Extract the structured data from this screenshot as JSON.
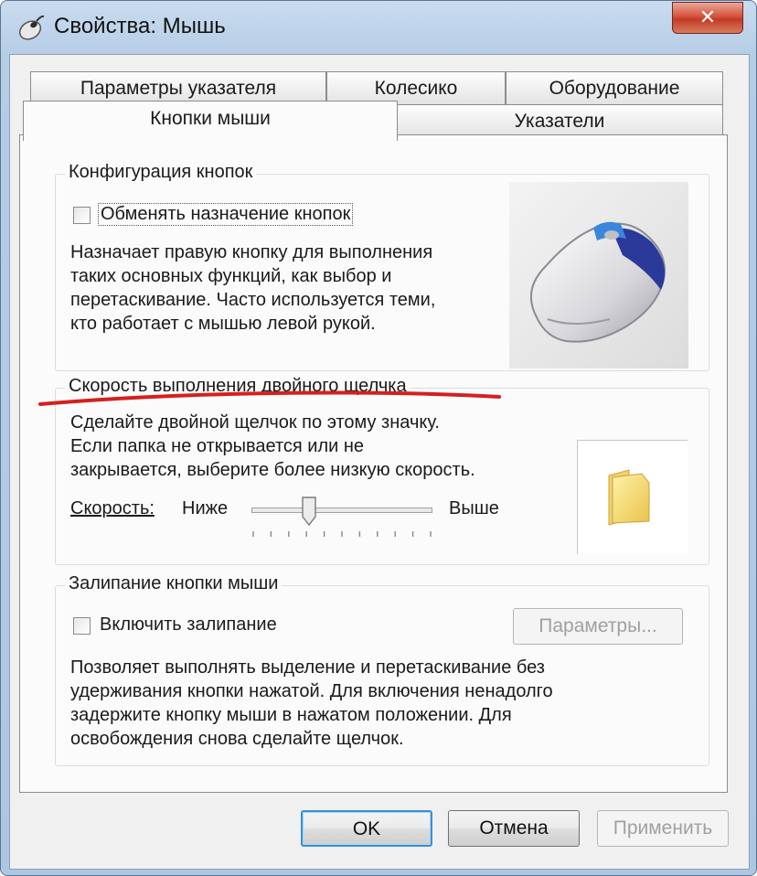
{
  "window": {
    "title": "Свойства: Мышь",
    "close_glyph": "✕"
  },
  "tabs_row1": [
    {
      "label": "Параметры указателя"
    },
    {
      "label": "Колесико"
    },
    {
      "label": "Оборудование"
    }
  ],
  "tabs_row2": [
    {
      "label": "Кнопки мыши",
      "active": true
    },
    {
      "label": "Указатели"
    }
  ],
  "buttons_config": {
    "legend": "Конфигурация кнопок",
    "checkbox": {
      "label": "Обменять назначение кнопок",
      "checked": false
    },
    "description": [
      "Назначает правую кнопку для выполнения",
      "таких основных функций, как выбор и",
      "перетаскивание. Часто используется теми,",
      "кто работает с мышью левой рукой."
    ],
    "image_icon": "mouse-icon"
  },
  "double_click": {
    "legend": "Скорость выполнения двойного щелчка",
    "description": [
      "Сделайте двойной щелчок по этому значку.",
      "Если папка не открывается или не",
      "закрывается, выберите более низкую скорость."
    ],
    "speed_label": "Скорость:",
    "slow_label": "Ниже",
    "fast_label": "Выше",
    "slider_level": 0.32,
    "tick_count": 11,
    "test_icon": "folder-icon"
  },
  "click_lock": {
    "legend": "Залипание кнопки мыши",
    "checkbox": {
      "label": "Включить залипание",
      "checked": false
    },
    "settings_button": "Параметры...",
    "description": [
      "Позволяет выполнять выделение и перетаскивание без",
      "удерживания кнопки нажатой. Для включения ненадолго",
      "задержите кнопку мыши в нажатом положении. Для",
      "освобождения снова сделайте щелчок."
    ]
  },
  "footer": {
    "ok": "OK",
    "cancel": "Отмена",
    "apply": "Применить"
  },
  "colors": {
    "annotation_underline": "#d42020"
  }
}
